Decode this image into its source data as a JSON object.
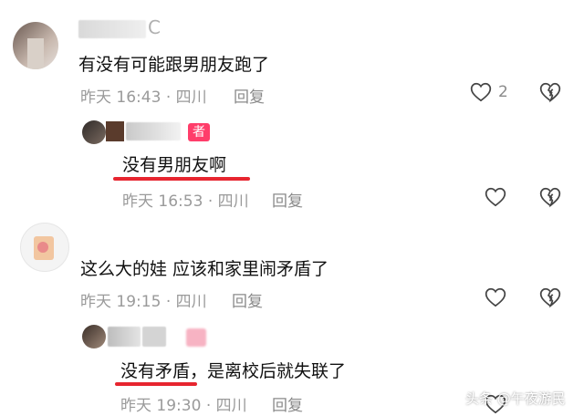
{
  "comments": [
    {
      "user_name_fragment": "C",
      "text": "有没有可能跟男朋友跑了",
      "time": "昨天 16:43",
      "location": "四川",
      "reply_label": "回复",
      "like_count": "2",
      "replies": [
        {
          "badge": "者",
          "text": "没有男朋友啊",
          "highlight": "没有男朋友啊",
          "time": "昨天 16:53",
          "location": "四川",
          "reply_label": "回复"
        }
      ]
    },
    {
      "text": "这么大的娃 应该和家里闹矛盾了",
      "time": "昨天 19:15",
      "location": "四川",
      "reply_label": "回复",
      "replies": [
        {
          "text_highlight": "没有矛盾",
          "text_rest": "，是离校后就失联了",
          "time": "昨天 19:30",
          "location": "四川",
          "reply_label": "回复"
        }
      ]
    }
  ],
  "meta_separator": "·",
  "watermark": "头条 @午夜游民",
  "colors": {
    "underline": "#e7252f",
    "badge": "#ff3d6a",
    "meta": "#9a9a9a"
  },
  "icons": {
    "like": "heart-outline-icon",
    "dislike": "broken-heart-icon"
  }
}
